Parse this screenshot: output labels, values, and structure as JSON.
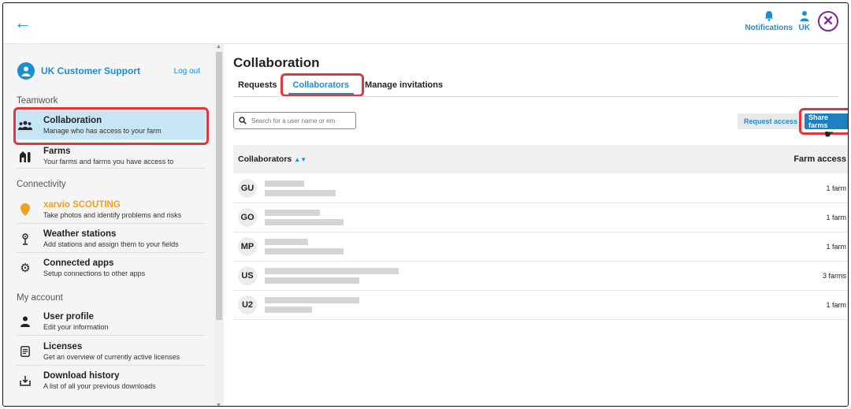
{
  "topbar": {
    "notifications_label": "Notifications",
    "user_label": "UK"
  },
  "sidebar": {
    "user_name": "UK Customer Support",
    "logout": "Log out",
    "sections": {
      "teamwork": "Teamwork",
      "connectivity": "Connectivity",
      "my_account": "My account"
    },
    "items": [
      {
        "title": "Collaboration",
        "sub": "Manage who has access to your farm",
        "icon": "group-icon"
      },
      {
        "title": "Farms",
        "sub": "Your farms and farms you have access to",
        "icon": "farm-icon"
      },
      {
        "title": "xarvio SCOUTING",
        "sub": "Take photos and identify problems and risks",
        "icon": "scouting-icon"
      },
      {
        "title": "Weather stations",
        "sub": "Add stations and assign them to your fields",
        "icon": "weather-station-icon"
      },
      {
        "title": "Connected apps",
        "sub": "Setup connections to other apps",
        "icon": "gear-icon"
      },
      {
        "title": "User profile",
        "sub": "Edit your information",
        "icon": "user-icon"
      },
      {
        "title": "Licenses",
        "sub": "Get an overview of currently active licenses",
        "icon": "license-icon"
      },
      {
        "title": "Download history",
        "sub": "A list of all your previous downloads",
        "icon": "download-icon"
      }
    ]
  },
  "main": {
    "title": "Collaboration",
    "tabs": [
      "Requests",
      "Collaborators",
      "Manage invitations"
    ],
    "search_placeholder": "Search for a user name or em",
    "request_access": "Request access",
    "share_farms": "Share farms",
    "columns": {
      "collaborators": "Collaborators",
      "farm_access": "Farm access"
    },
    "rows": [
      {
        "initials": "GU",
        "access": "1 farm"
      },
      {
        "initials": "GO",
        "access": "1 farm"
      },
      {
        "initials": "MP",
        "access": "1 farm"
      },
      {
        "initials": "US",
        "access": "3 farms"
      },
      {
        "initials": "U2",
        "access": "1 farm"
      }
    ]
  },
  "colors": {
    "accent": "#1a8fd0",
    "highlight": "#e2363f",
    "scouting": "#f0a020",
    "close": "#7a2a8c"
  }
}
